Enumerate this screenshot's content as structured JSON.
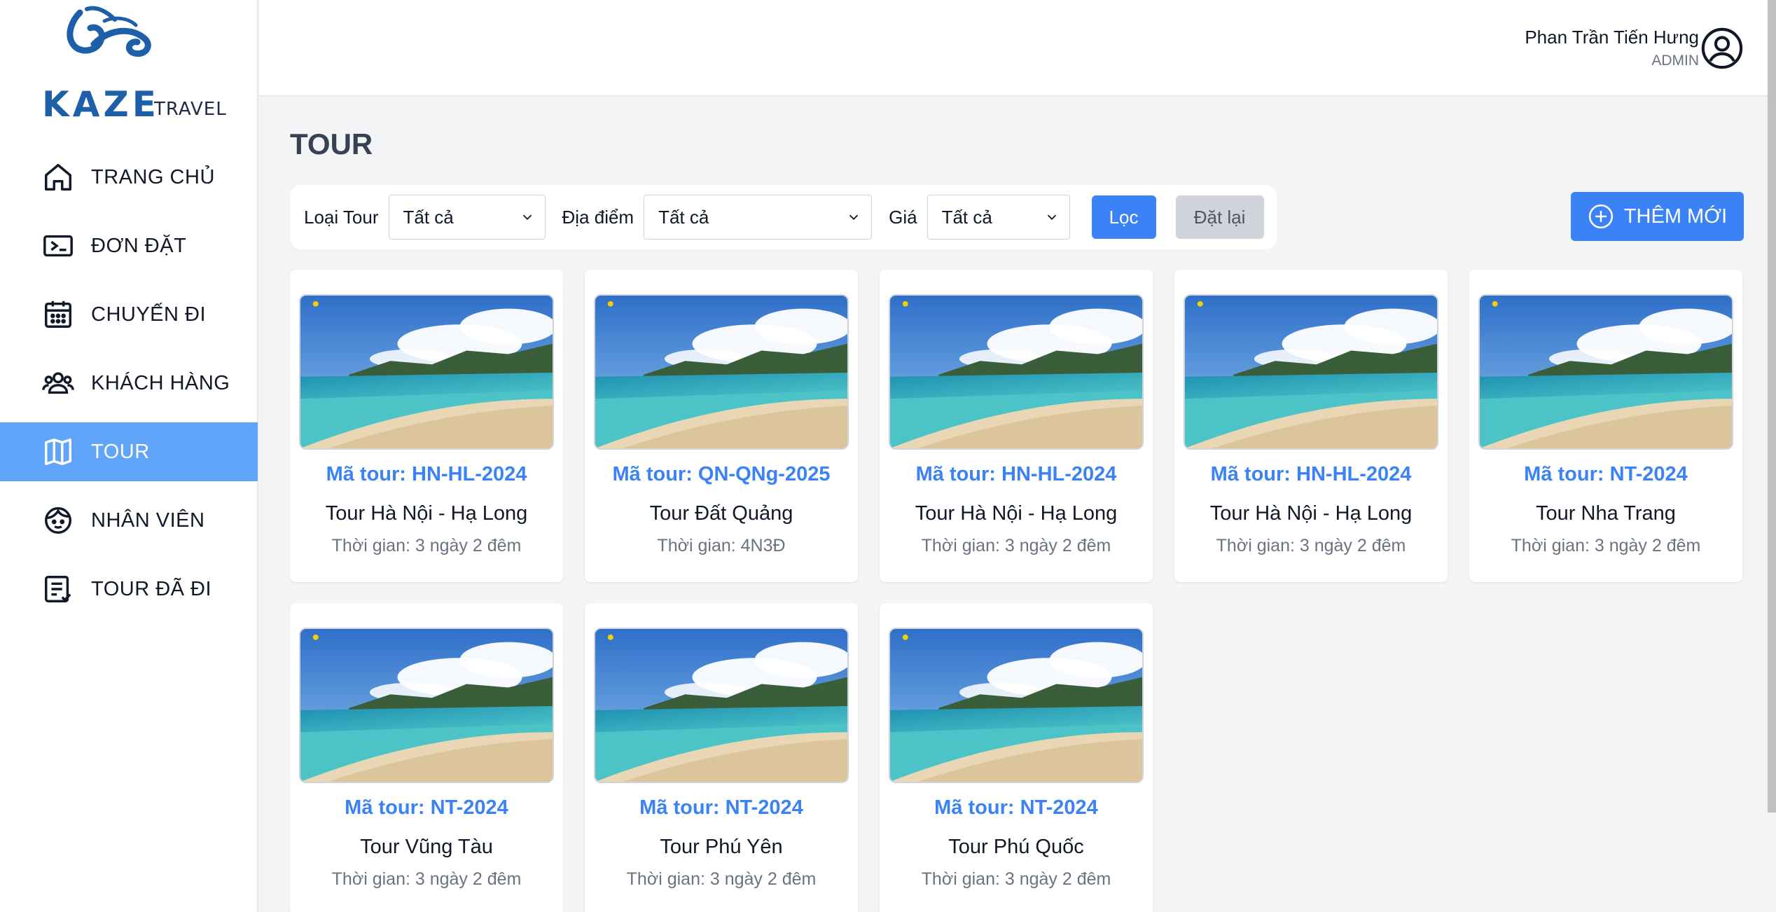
{
  "brand": {
    "name": "KAZE",
    "sub": "TRAVEL"
  },
  "sidebar": {
    "items": [
      {
        "label": "TRANG CHỦ",
        "icon": "home-icon",
        "active": false
      },
      {
        "label": "ĐƠN ĐẶT",
        "icon": "ticket-icon",
        "active": false
      },
      {
        "label": "CHUYẾN ĐI",
        "icon": "calendar-icon",
        "active": false
      },
      {
        "label": "KHÁCH HÀNG",
        "icon": "users-icon",
        "active": false
      },
      {
        "label": "TOUR",
        "icon": "map-icon",
        "active": true
      },
      {
        "label": "NHÂN VIÊN",
        "icon": "face-icon",
        "active": false
      },
      {
        "label": "TOUR ĐÃ ĐI",
        "icon": "checklist-icon",
        "active": false
      }
    ]
  },
  "header": {
    "user_name": "Phan Trần Tiến Hưng",
    "user_role": "ADMIN"
  },
  "main": {
    "title": "TOUR",
    "filters": {
      "tour_type_label": "Loại Tour",
      "tour_type_value": "Tất cả",
      "location_label": "Địa điểm",
      "location_value": "Tất cả",
      "price_label": "Giá",
      "price_value": "Tất cả",
      "filter_button": "Lọc",
      "reset_button": "Đặt lại"
    },
    "add_button": "THÊM MỚI",
    "tours": [
      {
        "code": "Mã tour: HN-HL-2024",
        "name": "Tour Hà Nội - Hạ Long",
        "duration": "Thời gian: 3 ngày 2 đêm"
      },
      {
        "code": "Mã tour: QN-QNg-2025",
        "name": "Tour Đất Quảng",
        "duration": "Thời gian: 4N3Đ"
      },
      {
        "code": "Mã tour: HN-HL-2024",
        "name": "Tour Hà Nội - Hạ Long",
        "duration": "Thời gian: 3 ngày 2 đêm"
      },
      {
        "code": "Mã tour: HN-HL-2024",
        "name": "Tour Hà Nội - Hạ Long",
        "duration": "Thời gian: 3 ngày 2 đêm"
      },
      {
        "code": "Mã tour: NT-2024",
        "name": "Tour Nha Trang",
        "duration": "Thời gian: 3 ngày 2 đêm"
      },
      {
        "code": "Mã tour: NT-2024",
        "name": "Tour Vũng Tàu",
        "duration": "Thời gian: 3 ngày 2 đêm"
      },
      {
        "code": "Mã tour: NT-2024",
        "name": "Tour Phú Yên",
        "duration": "Thời gian: 3 ngày 2 đêm"
      },
      {
        "code": "Mã tour: NT-2024",
        "name": "Tour Phú Quốc",
        "duration": "Thời gian: 3 ngày 2 đêm"
      }
    ]
  },
  "colors": {
    "accent": "#3b82f6",
    "active_nav": "#60a5fa",
    "brand": "#1d5fa8"
  }
}
